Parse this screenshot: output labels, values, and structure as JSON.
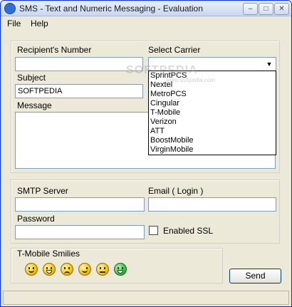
{
  "window": {
    "title": "SMS - Text and Numeric Messaging - Evaluation",
    "controls": {
      "minimize": "–",
      "maximize": "□",
      "close": "✕"
    }
  },
  "menu": {
    "file": "File",
    "help": "Help"
  },
  "form": {
    "recipient_label": "Recipient's Number",
    "recipient_value": "",
    "subject_label": "Subject",
    "subject_value": "SOFTPEDIA",
    "message_label": "Message",
    "message_value": "",
    "carrier_label": "Select Carrier",
    "carrier_selected": "",
    "carrier_options": [
      "SprintPCS",
      "Nextel",
      "MetroPCS",
      "Cingular",
      "T-Mobile",
      "Verizon",
      "ATT",
      "BoostMobile",
      "VirginMobile"
    ]
  },
  "smtp": {
    "server_label": "SMTP Server",
    "server_value": "",
    "email_label": "Email ( Login )",
    "email_value": "",
    "password_label": "Password",
    "password_value": "",
    "ssl_label": "Enabled SSL",
    "ssl_checked": false
  },
  "smilies": {
    "label": "T-Mobile Smilies",
    "items": [
      "smile-icon",
      "grin-icon",
      "sad-icon",
      "wink-icon",
      "confused-icon",
      "big-grin-icon"
    ]
  },
  "send_label": "Send",
  "watermark": {
    "text": "SOFTPEDIA",
    "url": "www.softpedia.com"
  }
}
